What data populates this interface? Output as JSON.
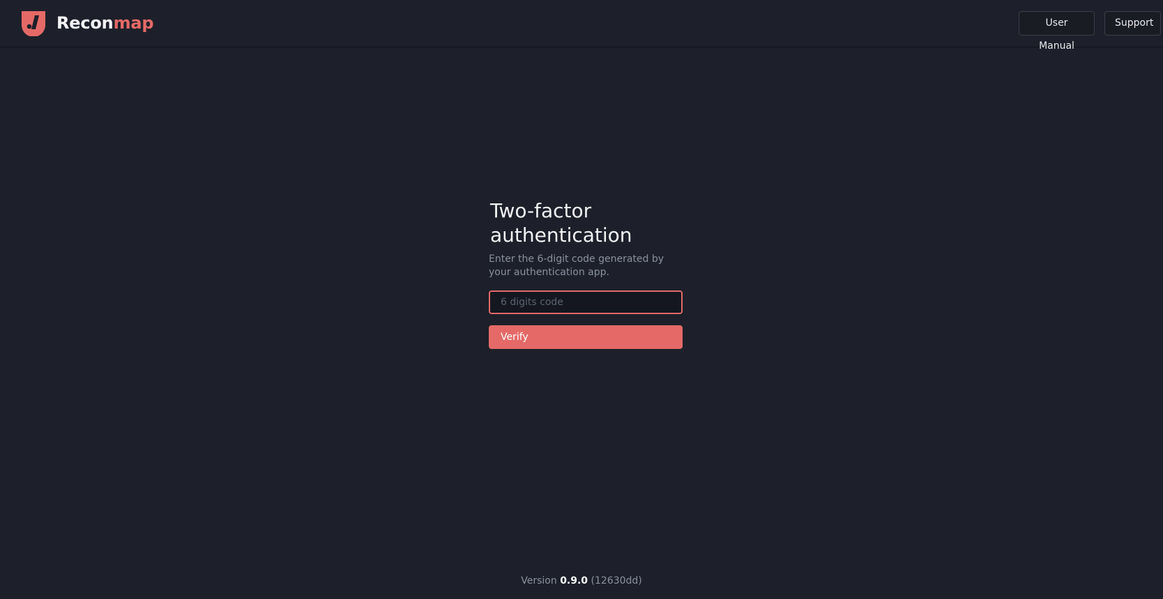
{
  "header": {
    "logo_icon": "reconmap-logo-icon",
    "brand_primary": "Recon",
    "brand_accent": "map",
    "nav": [
      {
        "label": "User Manual"
      },
      {
        "label": "Support"
      }
    ]
  },
  "auth": {
    "title": "Two-factor authentication",
    "subtitle": "Enter the 6-digit code generated by your authentication app.",
    "code_placeholder": "6 digits code",
    "code_value": "",
    "verify_label": "Verify"
  },
  "footer": {
    "prefix": "Version",
    "version": "0.9.0",
    "build": "(12630dd)"
  },
  "colors": {
    "background": "#1d202a",
    "accent": "#e56a67",
    "muted_text": "#8b90a0"
  }
}
